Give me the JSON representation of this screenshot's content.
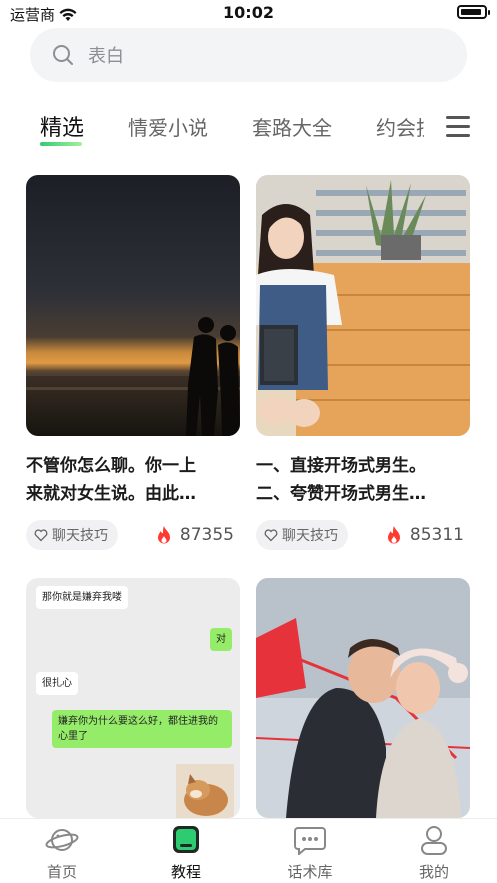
{
  "status_bar": {
    "carrier": "运营商",
    "time": "10:02",
    "battery_level": 0.9
  },
  "search": {
    "placeholder": "表白",
    "icon": "search-icon"
  },
  "tabs": [
    {
      "label": "精选",
      "active": true
    },
    {
      "label": "情爱小说",
      "active": false
    },
    {
      "label": "套路大全",
      "active": false
    },
    {
      "label": "约会技巧",
      "active": false
    }
  ],
  "menu_icon": "menu-icon",
  "cards": [
    {
      "title_line1": "不管你怎么聊。你一上",
      "title_line2": "来就对女生说。由此…",
      "tag": "聊天技巧",
      "views": "87355",
      "image": "sunset-couple-photo"
    },
    {
      "title_line1": "一、直接开场式男生。",
      "title_line2": "二、夸赞开场式男生…",
      "tag": "聊天技巧",
      "views": "85311",
      "image": "girl-in-library-photo"
    },
    {
      "image": "chat-screenshot",
      "chat": [
        {
          "side": "left",
          "text": "那你就是嫌弃我喽"
        },
        {
          "side": "right",
          "text": "对"
        },
        {
          "side": "left",
          "text": "很扎心"
        },
        {
          "side": "right",
          "text": "嫌弃你为什么要这么好，都住进我的心里了"
        }
      ]
    },
    {
      "image": "couple-with-red-ribbon-photo"
    }
  ],
  "bottom_nav": [
    {
      "label": "首页",
      "icon": "planet-icon",
      "active": false
    },
    {
      "label": "教程",
      "icon": "tutorial-icon",
      "active": true
    },
    {
      "label": "话术库",
      "icon": "chat-bubble-icon",
      "active": false
    },
    {
      "label": "我的",
      "icon": "profile-icon",
      "active": false
    }
  ],
  "colors": {
    "accent_green": "#2ecc71",
    "fire_red": "#ff3b30",
    "chat_green": "#95ec69"
  }
}
